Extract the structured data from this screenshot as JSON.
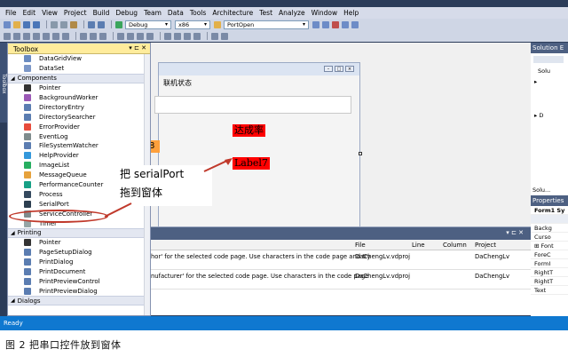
{
  "menu": [
    "File",
    "Edit",
    "View",
    "Project",
    "Build",
    "Debug",
    "Team",
    "Data",
    "Tools",
    "Architecture",
    "Test",
    "Analyze",
    "Window",
    "Help"
  ],
  "toolbar": {
    "config_value": "Debug",
    "platform_value": "x86",
    "target_value": "PortOpen"
  },
  "toolbox": {
    "title": "Toolbox",
    "controls": "▾ ⊏ ✕",
    "side_tab": "Toolbox",
    "items": [
      {
        "kind": "item",
        "label": "DataGridView",
        "color": "#6a8bc0"
      },
      {
        "kind": "item",
        "label": "DataSet",
        "color": "#7c97c7"
      },
      {
        "kind": "category",
        "label": "Components"
      },
      {
        "kind": "item",
        "label": "Pointer",
        "color": "#333333"
      },
      {
        "kind": "item",
        "label": "BackgroundWorker",
        "color": "#9b59b6"
      },
      {
        "kind": "item",
        "label": "DirectoryEntry",
        "color": "#5b7db1"
      },
      {
        "kind": "item",
        "label": "DirectorySearcher",
        "color": "#5b7db1"
      },
      {
        "kind": "item",
        "label": "ErrorProvider",
        "color": "#e74c3c"
      },
      {
        "kind": "item",
        "label": "EventLog",
        "color": "#7f8c8d"
      },
      {
        "kind": "item",
        "label": "FileSystemWatcher",
        "color": "#5b7db1"
      },
      {
        "kind": "item",
        "label": "HelpProvider",
        "color": "#3498db"
      },
      {
        "kind": "item",
        "label": "ImageList",
        "color": "#27ae60"
      },
      {
        "kind": "item",
        "label": "MessageQueue",
        "color": "#e6a23c"
      },
      {
        "kind": "item",
        "label": "PerformanceCounter",
        "color": "#16a085"
      },
      {
        "kind": "item",
        "label": "Process",
        "color": "#34495e"
      },
      {
        "kind": "item",
        "label": "SerialPort",
        "color": "#2c3e50"
      },
      {
        "kind": "item",
        "label": "ServiceController",
        "color": "#7f8c8d"
      },
      {
        "kind": "item",
        "label": "Timer",
        "color": "#95a5a6"
      },
      {
        "kind": "category",
        "label": "Printing"
      },
      {
        "kind": "item",
        "label": "Pointer",
        "color": "#333333"
      },
      {
        "kind": "item",
        "label": "PageSetupDialog",
        "color": "#5b7db1"
      },
      {
        "kind": "item",
        "label": "PrintDialog",
        "color": "#5b7db1"
      },
      {
        "kind": "item",
        "label": "PrintDocument",
        "color": "#5b7db1"
      },
      {
        "kind": "item",
        "label": "PrintPreviewControl",
        "color": "#5b7db1"
      },
      {
        "kind": "item",
        "label": "PrintPreviewDialog",
        "color": "#5b7db1"
      },
      {
        "kind": "category",
        "label": "Dialogs"
      }
    ]
  },
  "designer": {
    "form_label": "联机状态",
    "red_label_1": "达成率",
    "red_label_2": "Label7",
    "partial_glyph": "8"
  },
  "callout": {
    "line1": "把 serialPort",
    "line2": "拖到窗体"
  },
  "error_list": {
    "controls": "▾ ⊏ ✕",
    "columns": {
      "file": "File",
      "line": "Line",
      "column": "Column",
      "project": "Project"
    },
    "rows": [
      {
        "desc": "hor' for the selected code page. Use characters in the code page and try",
        "file": "DaChengLv.vdproj",
        "project": "DaChengLv"
      },
      {
        "desc": "nufacturer' for the selected code page. Use characters in the code page",
        "file": "DaChengLv.vdproj",
        "project": "DaChengLv"
      }
    ]
  },
  "solution_explorer": {
    "title": "Solution E",
    "nodes": [
      "Solu",
      "▸",
      "▸ D"
    ],
    "tab_label": "Solu..."
  },
  "properties": {
    "title": "Properties",
    "object": "Form1 Sy",
    "items": [
      "Backg",
      "Curso",
      "⊞ Font",
      "ForeC",
      "FormI",
      "RightT",
      "RightT",
      "Text"
    ]
  },
  "status": "Ready",
  "caption": "图 2  把串口控件放到窗体"
}
